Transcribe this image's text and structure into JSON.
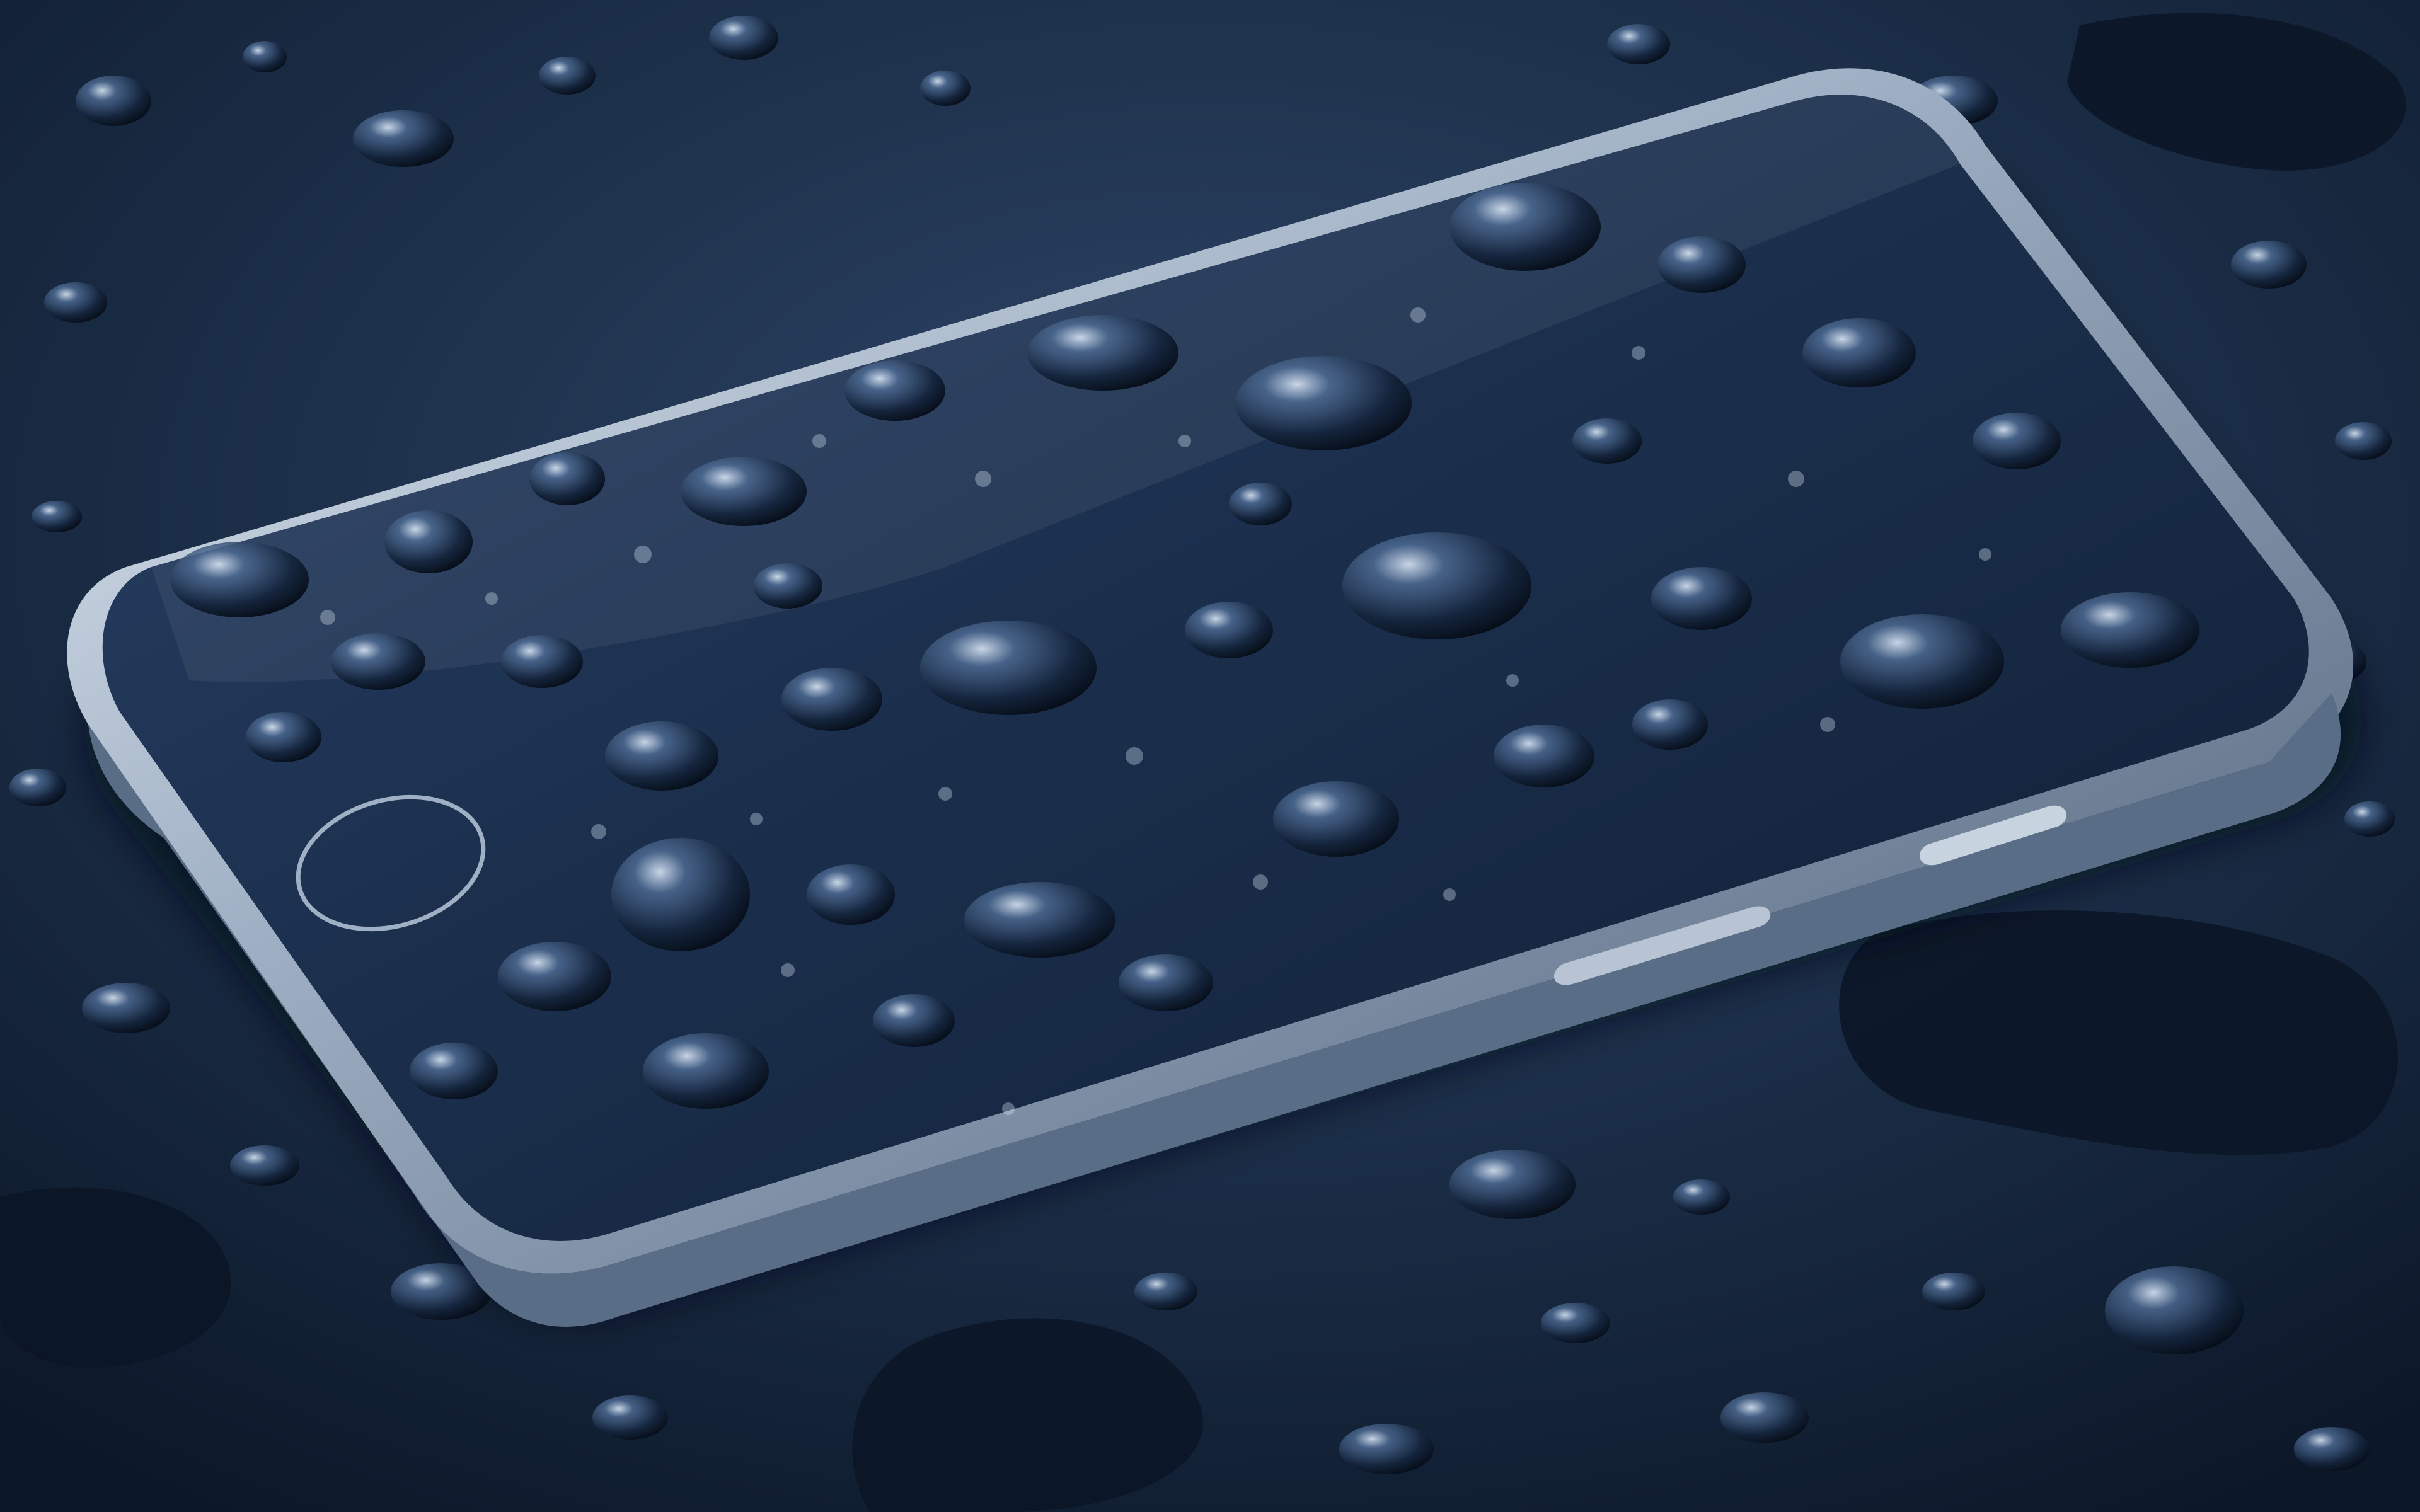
{
  "scene": {
    "subject": "smartphone-on-wet-surface",
    "palette": {
      "surface_dark": "#0b1626",
      "surface_mid": "#1a2c45",
      "surface_light": "#2e4668",
      "glass_dark": "#0f1e33",
      "glass_mid": "#22385a",
      "frame_light": "#e8eef5",
      "frame_mid": "#9fb0c4",
      "frame_dark": "#4b5d75",
      "drop_highlight": "#dbe8f7",
      "drop_shadow": "#060d18"
    },
    "icons": {
      "home_button": "home-button-ring",
      "side_button": "side-button"
    }
  }
}
